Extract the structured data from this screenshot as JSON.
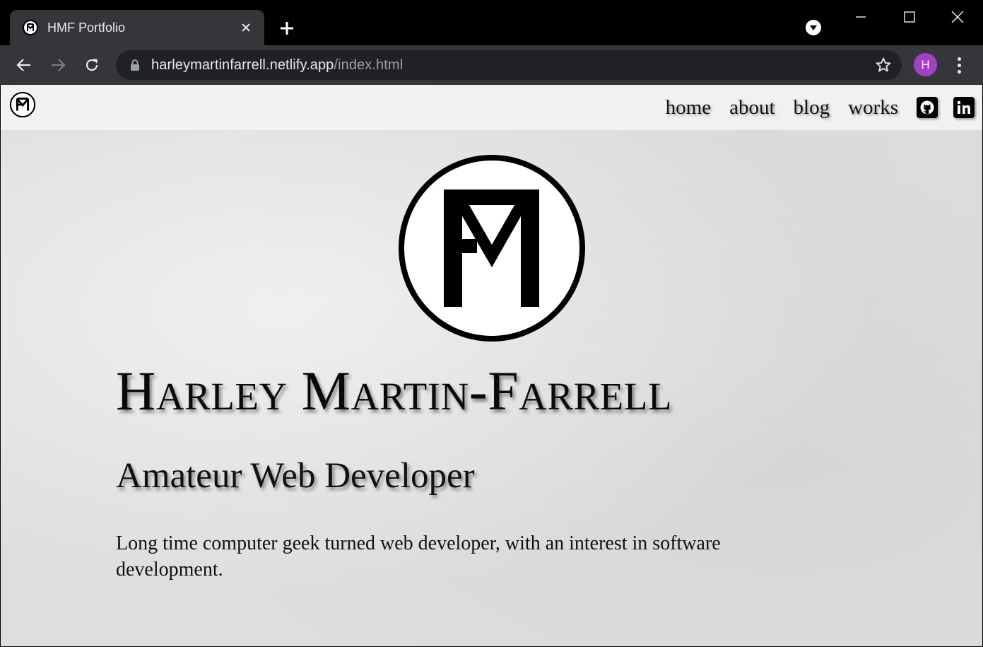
{
  "browser": {
    "tab_title": "HMF Portfolio",
    "url_host": "harleymartinfarrell.netlify.app",
    "url_path": "/index.html",
    "profile_initial": "H",
    "accent_colors": {
      "profile": "#a142c4",
      "chrome_dark": "#35363a",
      "omnibox": "#202124"
    }
  },
  "site": {
    "nav": {
      "links": [
        "home",
        "about",
        "blog",
        "works"
      ],
      "icons": [
        "github-icon",
        "linkedin-icon"
      ]
    },
    "hero": {
      "name": "Harley Martin-Farrell",
      "role": "Amateur Web Developer",
      "bio": "Long time computer geek turned web developer, with an interest in software development."
    }
  }
}
